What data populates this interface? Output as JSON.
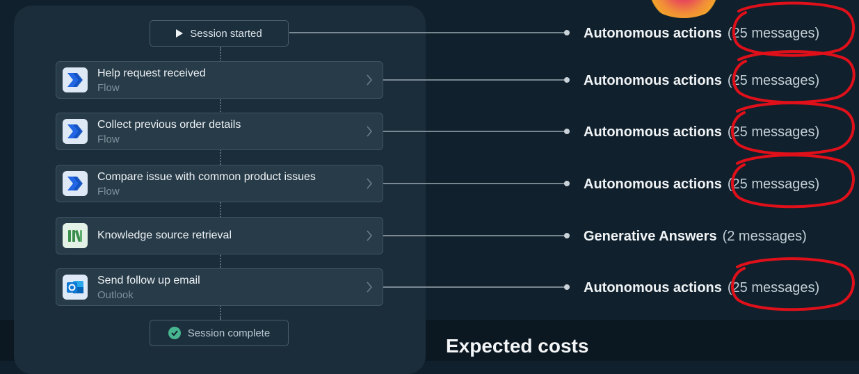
{
  "flow": {
    "start_label": "Session started",
    "end_label": "Session complete",
    "steps": [
      {
        "title": "Help request received",
        "subtitle": "Flow",
        "icon": "power-automate-icon"
      },
      {
        "title": "Collect previous order details",
        "subtitle": "Flow",
        "icon": "power-automate-icon"
      },
      {
        "title": "Compare issue with common product issues",
        "subtitle": "Flow",
        "icon": "power-automate-icon"
      },
      {
        "title": "Knowledge source retrieval",
        "subtitle": "",
        "icon": "knowledge-source-icon"
      },
      {
        "title": "Send follow up email",
        "subtitle": "Outlook",
        "icon": "outlook-icon"
      }
    ]
  },
  "billing": [
    {
      "name": "Autonomous actions",
      "count": "(25 messages)",
      "circled": true
    },
    {
      "name": "Autonomous actions",
      "count": "(25 messages)",
      "circled": true
    },
    {
      "name": "Autonomous actions",
      "count": "(25 messages)",
      "circled": true
    },
    {
      "name": "Autonomous actions",
      "count": "(25 messages)",
      "circled": true
    },
    {
      "name": "Generative Answers",
      "count": "(2 messages)",
      "circled": false
    },
    {
      "name": "Autonomous actions",
      "count": "(25 messages)",
      "circled": true
    }
  ],
  "costs": {
    "heading": "Expected costs"
  },
  "colors": {
    "background": "#10202c",
    "panel": "#1b2d3a",
    "card": "#273b48",
    "annotation_red": "#e0101a",
    "success_green": "#47b58f",
    "flow_blue": "#2266e3"
  }
}
